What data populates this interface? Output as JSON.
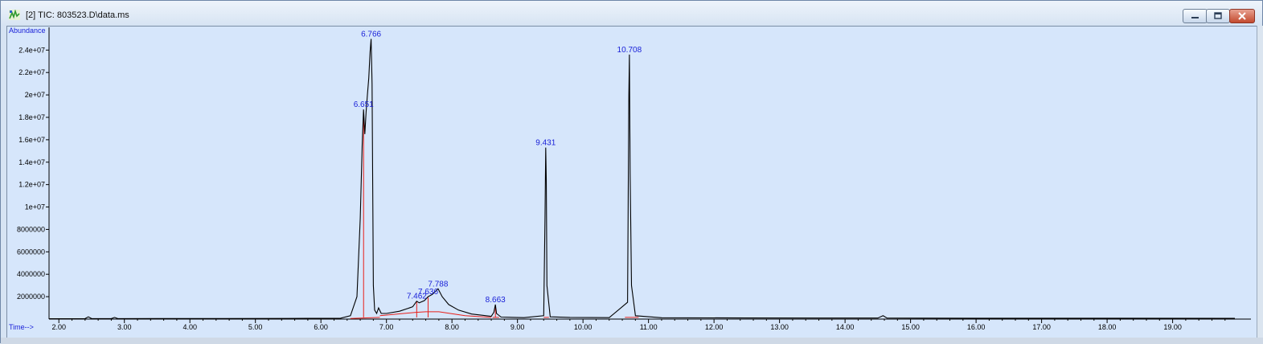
{
  "window": {
    "title": "[2] TIC: 803523.D\\data.ms",
    "controls": [
      "minimize",
      "maximize",
      "close"
    ],
    "icon": "chromatogram-app-icon"
  },
  "chart_data": {
    "type": "line",
    "ylabel": "Abundance",
    "xlabel": "Time-->",
    "xlim": [
      1.85,
      19.95
    ],
    "ylim": [
      0,
      25600000
    ],
    "x_ticks": [
      "2.00",
      "3.00",
      "4.00",
      "5.00",
      "6.00",
      "7.00",
      "8.00",
      "9.00",
      "10.00",
      "11.00",
      "12.00",
      "13.00",
      "14.00",
      "15.00",
      "16.00",
      "17.00",
      "18.00",
      "19.00"
    ],
    "y_ticks": [
      "2000000",
      "4000000",
      "6000000",
      "8000000",
      "1e+07",
      "1.2e+07",
      "1.4e+07",
      "1.6e+07",
      "1.8e+07",
      "2e+07",
      "2.2e+07",
      "2.4e+07"
    ],
    "peak_labels": [
      {
        "rt": 6.766,
        "label": "6.766",
        "abundance": 25000000
      },
      {
        "rt": 6.651,
        "label": "6.651",
        "abundance": 18700000
      },
      {
        "rt": 7.462,
        "label": "7.462",
        "abundance": 1600000
      },
      {
        "rt": 7.636,
        "label": "7.636",
        "abundance": 2000000
      },
      {
        "rt": 7.788,
        "label": "7.788",
        "abundance": 2700000
      },
      {
        "rt": 8.663,
        "label": "8.663",
        "abundance": 1300000
      },
      {
        "rt": 9.431,
        "label": "9.431",
        "abundance": 15300000
      },
      {
        "rt": 10.708,
        "label": "10.708",
        "abundance": 23600000
      }
    ],
    "integration_drops": [
      6.651,
      7.462,
      7.636,
      8.663,
      9.431,
      10.708
    ],
    "trace": [
      [
        1.85,
        30000
      ],
      [
        2.4,
        40000
      ],
      [
        2.45,
        200000
      ],
      [
        2.5,
        40000
      ],
      [
        2.8,
        40000
      ],
      [
        2.85,
        150000
      ],
      [
        2.9,
        40000
      ],
      [
        3.5,
        50000
      ],
      [
        4.5,
        50000
      ],
      [
        5.5,
        60000
      ],
      [
        6.3,
        80000
      ],
      [
        6.45,
        300000
      ],
      [
        6.55,
        2000000
      ],
      [
        6.6,
        9000000
      ],
      [
        6.63,
        15500000
      ],
      [
        6.651,
        18700000
      ],
      [
        6.67,
        16500000
      ],
      [
        6.69,
        18500000
      ],
      [
        6.71,
        20000000
      ],
      [
        6.73,
        21500000
      ],
      [
        6.75,
        23800000
      ],
      [
        6.766,
        25000000
      ],
      [
        6.78,
        21000000
      ],
      [
        6.79,
        12000000
      ],
      [
        6.8,
        3000000
      ],
      [
        6.82,
        800000
      ],
      [
        6.85,
        500000
      ],
      [
        6.88,
        1000000
      ],
      [
        6.92,
        500000
      ],
      [
        7.0,
        500000
      ],
      [
        7.2,
        700000
      ],
      [
        7.4,
        1100000
      ],
      [
        7.462,
        1600000
      ],
      [
        7.5,
        1450000
      ],
      [
        7.58,
        1650000
      ],
      [
        7.636,
        2000000
      ],
      [
        7.7,
        2200000
      ],
      [
        7.788,
        2700000
      ],
      [
        7.85,
        2000000
      ],
      [
        7.95,
        1300000
      ],
      [
        8.1,
        800000
      ],
      [
        8.3,
        450000
      ],
      [
        8.6,
        250000
      ],
      [
        8.64,
        600000
      ],
      [
        8.663,
        1300000
      ],
      [
        8.68,
        500000
      ],
      [
        8.75,
        180000
      ],
      [
        9.1,
        130000
      ],
      [
        9.4,
        300000
      ],
      [
        9.42,
        9000000
      ],
      [
        9.431,
        15300000
      ],
      [
        9.44,
        12500000
      ],
      [
        9.45,
        3000000
      ],
      [
        9.5,
        200000
      ],
      [
        9.8,
        150000
      ],
      [
        10.4,
        130000
      ],
      [
        10.68,
        1500000
      ],
      [
        10.7,
        20000000
      ],
      [
        10.708,
        23600000
      ],
      [
        10.72,
        13000000
      ],
      [
        10.74,
        3000000
      ],
      [
        10.8,
        300000
      ],
      [
        11.2,
        120000
      ],
      [
        12.5,
        100000
      ],
      [
        14.5,
        90000
      ],
      [
        14.58,
        300000
      ],
      [
        14.64,
        90000
      ],
      [
        16.0,
        80000
      ],
      [
        19.95,
        70000
      ]
    ]
  }
}
